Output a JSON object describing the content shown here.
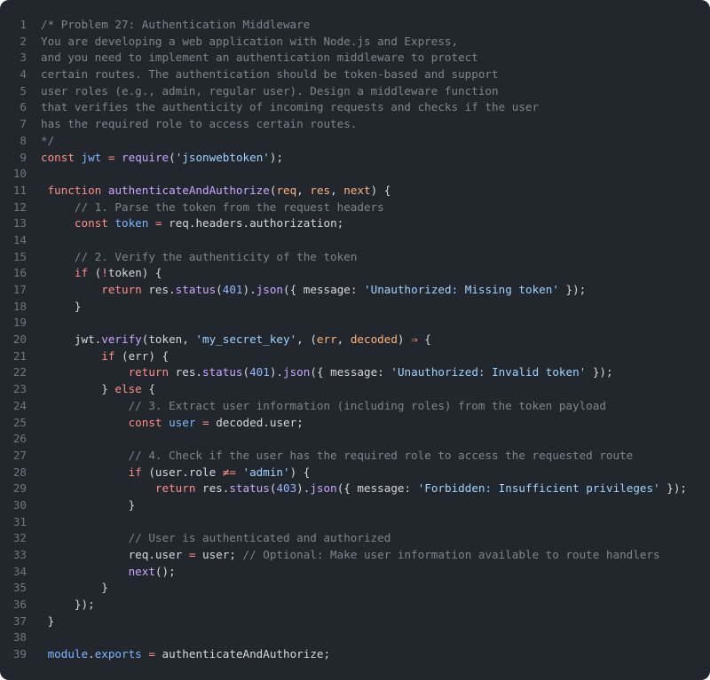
{
  "lines": [
    {
      "n": "1",
      "tokens": [
        {
          "t": "/* Problem 27: Authentication Middleware",
          "c": "comment"
        }
      ]
    },
    {
      "n": "2",
      "tokens": [
        {
          "t": "You are developing a web application with Node.js and Express,",
          "c": "comment"
        }
      ]
    },
    {
      "n": "3",
      "tokens": [
        {
          "t": "and you need to implement an authentication middleware to protect",
          "c": "comment"
        }
      ]
    },
    {
      "n": "4",
      "tokens": [
        {
          "t": "certain routes. The authentication should be token-based and support",
          "c": "comment"
        }
      ]
    },
    {
      "n": "5",
      "tokens": [
        {
          "t": "user roles (e.g., admin, regular user). Design a middleware function",
          "c": "comment"
        }
      ]
    },
    {
      "n": "6",
      "tokens": [
        {
          "t": "that verifies the authenticity of incoming requests and checks if the user",
          "c": "comment"
        }
      ]
    },
    {
      "n": "7",
      "tokens": [
        {
          "t": "has the required role to access certain routes.",
          "c": "comment"
        }
      ]
    },
    {
      "n": "8",
      "tokens": [
        {
          "t": "*/",
          "c": "comment"
        }
      ]
    },
    {
      "n": "9",
      "tokens": [
        {
          "t": "const",
          "c": "kw"
        },
        {
          "t": " ",
          "c": "plain"
        },
        {
          "t": "jwt",
          "c": "var"
        },
        {
          "t": " ",
          "c": "plain"
        },
        {
          "t": "=",
          "c": "op"
        },
        {
          "t": " ",
          "c": "plain"
        },
        {
          "t": "require",
          "c": "fn"
        },
        {
          "t": "(",
          "c": "plain"
        },
        {
          "t": "'jsonwebtoken'",
          "c": "str"
        },
        {
          "t": ");",
          "c": "plain"
        }
      ]
    },
    {
      "n": "10",
      "tokens": []
    },
    {
      "n": "11",
      "tokens": [
        {
          "t": " ",
          "c": "plain"
        },
        {
          "t": "function",
          "c": "kw"
        },
        {
          "t": " ",
          "c": "plain"
        },
        {
          "t": "authenticateAndAuthorize",
          "c": "fn"
        },
        {
          "t": "(",
          "c": "plain"
        },
        {
          "t": "req",
          "c": "param"
        },
        {
          "t": ", ",
          "c": "plain"
        },
        {
          "t": "res",
          "c": "param"
        },
        {
          "t": ", ",
          "c": "plain"
        },
        {
          "t": "next",
          "c": "param"
        },
        {
          "t": ") {",
          "c": "plain"
        }
      ]
    },
    {
      "n": "12",
      "tokens": [
        {
          "t": "     ",
          "c": "plain"
        },
        {
          "t": "// 1. Parse the token from the request headers",
          "c": "comment"
        }
      ]
    },
    {
      "n": "13",
      "tokens": [
        {
          "t": "     ",
          "c": "plain"
        },
        {
          "t": "const",
          "c": "kw"
        },
        {
          "t": " ",
          "c": "plain"
        },
        {
          "t": "token",
          "c": "var"
        },
        {
          "t": " ",
          "c": "plain"
        },
        {
          "t": "=",
          "c": "op"
        },
        {
          "t": " req.headers.authorization;",
          "c": "plain"
        }
      ]
    },
    {
      "n": "14",
      "tokens": []
    },
    {
      "n": "15",
      "tokens": [
        {
          "t": "     ",
          "c": "plain"
        },
        {
          "t": "// 2. Verify the authenticity of the token",
          "c": "comment"
        }
      ]
    },
    {
      "n": "16",
      "tokens": [
        {
          "t": "     ",
          "c": "plain"
        },
        {
          "t": "if",
          "c": "kw"
        },
        {
          "t": " (",
          "c": "plain"
        },
        {
          "t": "!",
          "c": "op"
        },
        {
          "t": "token) {",
          "c": "plain"
        }
      ]
    },
    {
      "n": "17",
      "tokens": [
        {
          "t": "         ",
          "c": "plain"
        },
        {
          "t": "return",
          "c": "kw"
        },
        {
          "t": " res.",
          "c": "plain"
        },
        {
          "t": "status",
          "c": "fn"
        },
        {
          "t": "(",
          "c": "plain"
        },
        {
          "t": "401",
          "c": "num"
        },
        {
          "t": ").",
          "c": "plain"
        },
        {
          "t": "json",
          "c": "fn"
        },
        {
          "t": "({ message: ",
          "c": "plain"
        },
        {
          "t": "'Unauthorized: Missing token'",
          "c": "str"
        },
        {
          "t": " });",
          "c": "plain"
        }
      ]
    },
    {
      "n": "18",
      "tokens": [
        {
          "t": "     }",
          "c": "plain"
        }
      ]
    },
    {
      "n": "19",
      "tokens": []
    },
    {
      "n": "20",
      "tokens": [
        {
          "t": "     jwt.",
          "c": "plain"
        },
        {
          "t": "verify",
          "c": "fn"
        },
        {
          "t": "(token, ",
          "c": "plain"
        },
        {
          "t": "'my_secret_key'",
          "c": "str"
        },
        {
          "t": ", (",
          "c": "plain"
        },
        {
          "t": "err",
          "c": "param"
        },
        {
          "t": ", ",
          "c": "plain"
        },
        {
          "t": "decoded",
          "c": "param"
        },
        {
          "t": ") ",
          "c": "plain"
        },
        {
          "t": "⇒",
          "c": "op"
        },
        {
          "t": " {",
          "c": "plain"
        }
      ]
    },
    {
      "n": "21",
      "tokens": [
        {
          "t": "         ",
          "c": "plain"
        },
        {
          "t": "if",
          "c": "kw"
        },
        {
          "t": " (err) {",
          "c": "plain"
        }
      ]
    },
    {
      "n": "22",
      "tokens": [
        {
          "t": "             ",
          "c": "plain"
        },
        {
          "t": "return",
          "c": "kw"
        },
        {
          "t": " res.",
          "c": "plain"
        },
        {
          "t": "status",
          "c": "fn"
        },
        {
          "t": "(",
          "c": "plain"
        },
        {
          "t": "401",
          "c": "num"
        },
        {
          "t": ").",
          "c": "plain"
        },
        {
          "t": "json",
          "c": "fn"
        },
        {
          "t": "({ message: ",
          "c": "plain"
        },
        {
          "t": "'Unauthorized: Invalid token'",
          "c": "str"
        },
        {
          "t": " });",
          "c": "plain"
        }
      ]
    },
    {
      "n": "23",
      "tokens": [
        {
          "t": "         } ",
          "c": "plain"
        },
        {
          "t": "else",
          "c": "kw"
        },
        {
          "t": " {",
          "c": "plain"
        }
      ]
    },
    {
      "n": "24",
      "tokens": [
        {
          "t": "             ",
          "c": "plain"
        },
        {
          "t": "// 3. Extract user information (including roles) from the token payload",
          "c": "comment"
        }
      ]
    },
    {
      "n": "25",
      "tokens": [
        {
          "t": "             ",
          "c": "plain"
        },
        {
          "t": "const",
          "c": "kw"
        },
        {
          "t": " ",
          "c": "plain"
        },
        {
          "t": "user",
          "c": "var"
        },
        {
          "t": " ",
          "c": "plain"
        },
        {
          "t": "=",
          "c": "op"
        },
        {
          "t": " decoded.user;",
          "c": "plain"
        }
      ]
    },
    {
      "n": "26",
      "tokens": []
    },
    {
      "n": "27",
      "tokens": [
        {
          "t": "             ",
          "c": "plain"
        },
        {
          "t": "// 4. Check if the user has the required role to access the requested route",
          "c": "comment"
        }
      ]
    },
    {
      "n": "28",
      "tokens": [
        {
          "t": "             ",
          "c": "plain"
        },
        {
          "t": "if",
          "c": "kw"
        },
        {
          "t": " (user.role ",
          "c": "plain"
        },
        {
          "t": "≠=",
          "c": "op"
        },
        {
          "t": " ",
          "c": "plain"
        },
        {
          "t": "'admin'",
          "c": "str"
        },
        {
          "t": ") {",
          "c": "plain"
        }
      ]
    },
    {
      "n": "29",
      "tokens": [
        {
          "t": "                 ",
          "c": "plain"
        },
        {
          "t": "return",
          "c": "kw"
        },
        {
          "t": " res.",
          "c": "plain"
        },
        {
          "t": "status",
          "c": "fn"
        },
        {
          "t": "(",
          "c": "plain"
        },
        {
          "t": "403",
          "c": "num"
        },
        {
          "t": ").",
          "c": "plain"
        },
        {
          "t": "json",
          "c": "fn"
        },
        {
          "t": "({ message: ",
          "c": "plain"
        },
        {
          "t": "'Forbidden: Insufficient privileges'",
          "c": "str"
        },
        {
          "t": " });",
          "c": "plain"
        }
      ]
    },
    {
      "n": "30",
      "tokens": [
        {
          "t": "             }",
          "c": "plain"
        }
      ]
    },
    {
      "n": "31",
      "tokens": []
    },
    {
      "n": "32",
      "tokens": [
        {
          "t": "             ",
          "c": "plain"
        },
        {
          "t": "// User is authenticated and authorized",
          "c": "comment"
        }
      ]
    },
    {
      "n": "33",
      "tokens": [
        {
          "t": "             req.user ",
          "c": "plain"
        },
        {
          "t": "=",
          "c": "op"
        },
        {
          "t": " user; ",
          "c": "plain"
        },
        {
          "t": "// Optional: Make user information available to route handlers",
          "c": "comment"
        }
      ]
    },
    {
      "n": "34",
      "tokens": [
        {
          "t": "             ",
          "c": "plain"
        },
        {
          "t": "next",
          "c": "fn"
        },
        {
          "t": "();",
          "c": "plain"
        }
      ]
    },
    {
      "n": "35",
      "tokens": [
        {
          "t": "         }",
          "c": "plain"
        }
      ]
    },
    {
      "n": "36",
      "tokens": [
        {
          "t": "     });",
          "c": "plain"
        }
      ]
    },
    {
      "n": "37",
      "tokens": [
        {
          "t": " }",
          "c": "plain"
        }
      ]
    },
    {
      "n": "38",
      "tokens": []
    },
    {
      "n": "39",
      "tokens": [
        {
          "t": " ",
          "c": "plain"
        },
        {
          "t": "module",
          "c": "var"
        },
        {
          "t": ".",
          "c": "plain"
        },
        {
          "t": "exports",
          "c": "var"
        },
        {
          "t": " ",
          "c": "plain"
        },
        {
          "t": "=",
          "c": "op"
        },
        {
          "t": " authenticateAndAuthorize;",
          "c": "plain"
        }
      ]
    }
  ]
}
